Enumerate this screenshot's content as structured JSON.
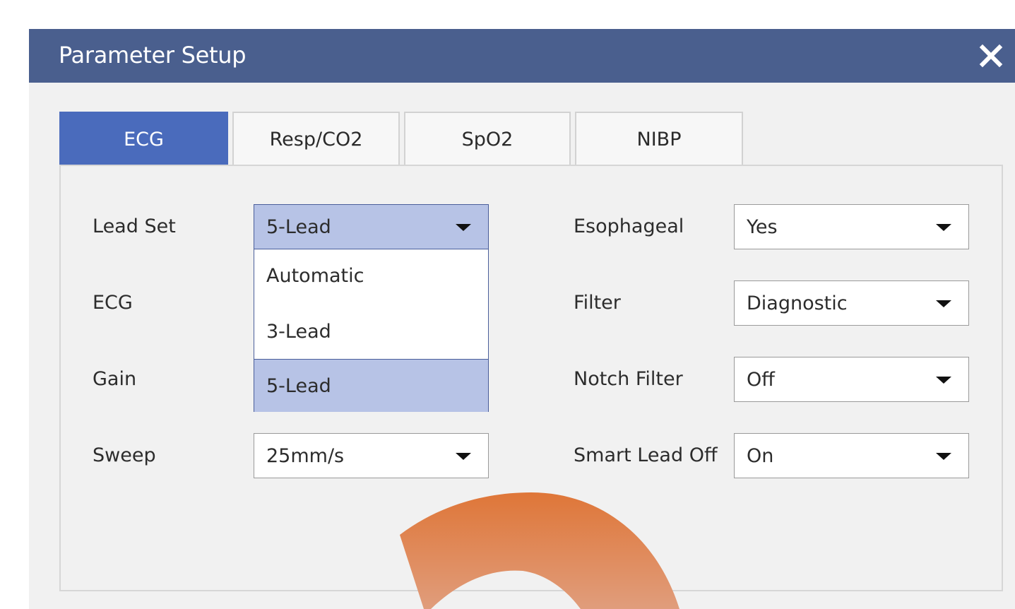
{
  "dialog": {
    "title": "Parameter Setup",
    "close_icon": "close-icon"
  },
  "tabs": [
    {
      "label": "ECG",
      "active": true
    },
    {
      "label": "Resp/CO2",
      "active": false
    },
    {
      "label": "SpO2",
      "active": false
    },
    {
      "label": "NIBP",
      "active": false
    }
  ],
  "left_fields": {
    "lead_set": {
      "label": "Lead Set",
      "value": "5-Lead"
    },
    "ecg": {
      "label": "ECG"
    },
    "gain": {
      "label": "Gain"
    },
    "sweep": {
      "label": "Sweep",
      "value": "25mm/s"
    }
  },
  "lead_set_dropdown": {
    "options": [
      "Automatic",
      "3-Lead",
      "5-Lead"
    ],
    "selected": "5-Lead"
  },
  "right_fields": {
    "esophageal": {
      "label": "Esophageal",
      "value": "Yes"
    },
    "filter": {
      "label": "Filter",
      "value": "Diagnostic"
    },
    "notch_filter": {
      "label": "Notch Filter",
      "value": "Off"
    },
    "smart_lead_off": {
      "label": "Smart Lead Off",
      "value": "On"
    }
  },
  "colors": {
    "titlebar": "#4a5f8e",
    "active_tab": "#4a6bbc",
    "selected_bg": "#b7c3e6",
    "overlay_orange": "#e07a40"
  }
}
